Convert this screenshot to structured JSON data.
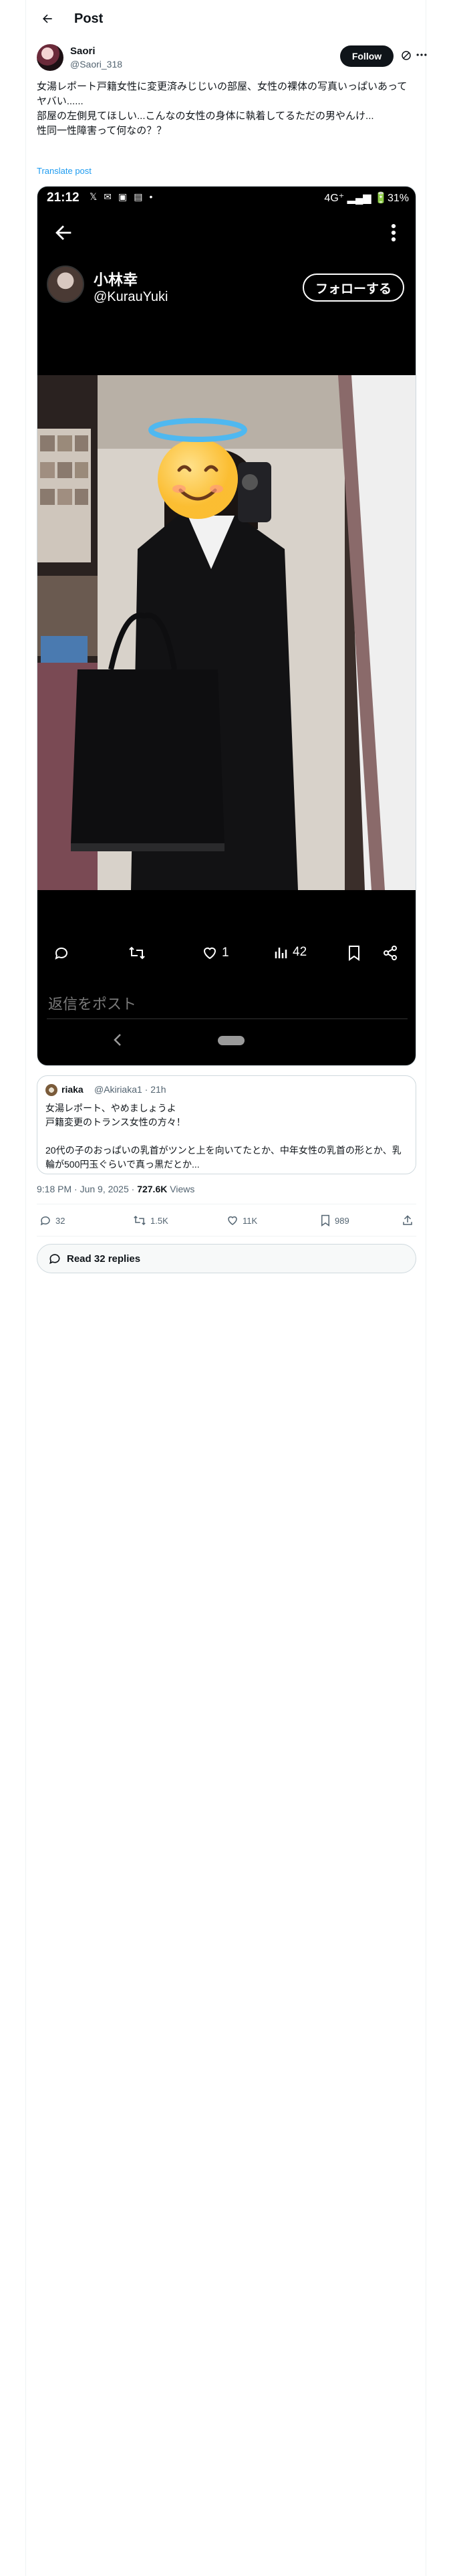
{
  "header": {
    "title": "Post"
  },
  "author": {
    "name": "Saori",
    "handle": "@Saori_318",
    "follow_label": "Follow"
  },
  "post": {
    "text": "女湯レポート戸籍女性に変更済みじじいの部屋、女性の裸体の写真いっぱいあってヤバい......\n部屋の左側見てほしい...こんなの女性の身体に執着してるただの男やんけ...\n性同一性障害って何なの？？",
    "translate_label": "Translate post"
  },
  "media": {
    "status_time": "21:12",
    "status_right": "4G⁺ ▂▄▆ 🔋31%",
    "profile_name": "小林幸",
    "profile_handle": "@KurauYuki",
    "follow_label": "フォローする",
    "likes": "1",
    "views": "42",
    "reply_placeholder": "返信をポスト"
  },
  "quote": {
    "name": "riaka",
    "handle_time": "@Akiriaka1 · 21h",
    "text": "女湯レポート、やめましょうよ\n戸籍変更のトランス女性の方々！\n\n20代の子のおっぱいの乳首がツンと上を向いてたとか、中年女性の乳首の形とか、乳輪が500円玉ぐらいで真っ黒だとか..."
  },
  "timestamp": {
    "time": "9:18 PM · Jun 9, 2025 · ",
    "views": "727.6K",
    "views_label": " Views"
  },
  "stats": {
    "replies": "32",
    "reposts": "1.5K",
    "likes": "11K",
    "bookmarks": "989"
  },
  "read_replies_label": "Read 32 replies"
}
